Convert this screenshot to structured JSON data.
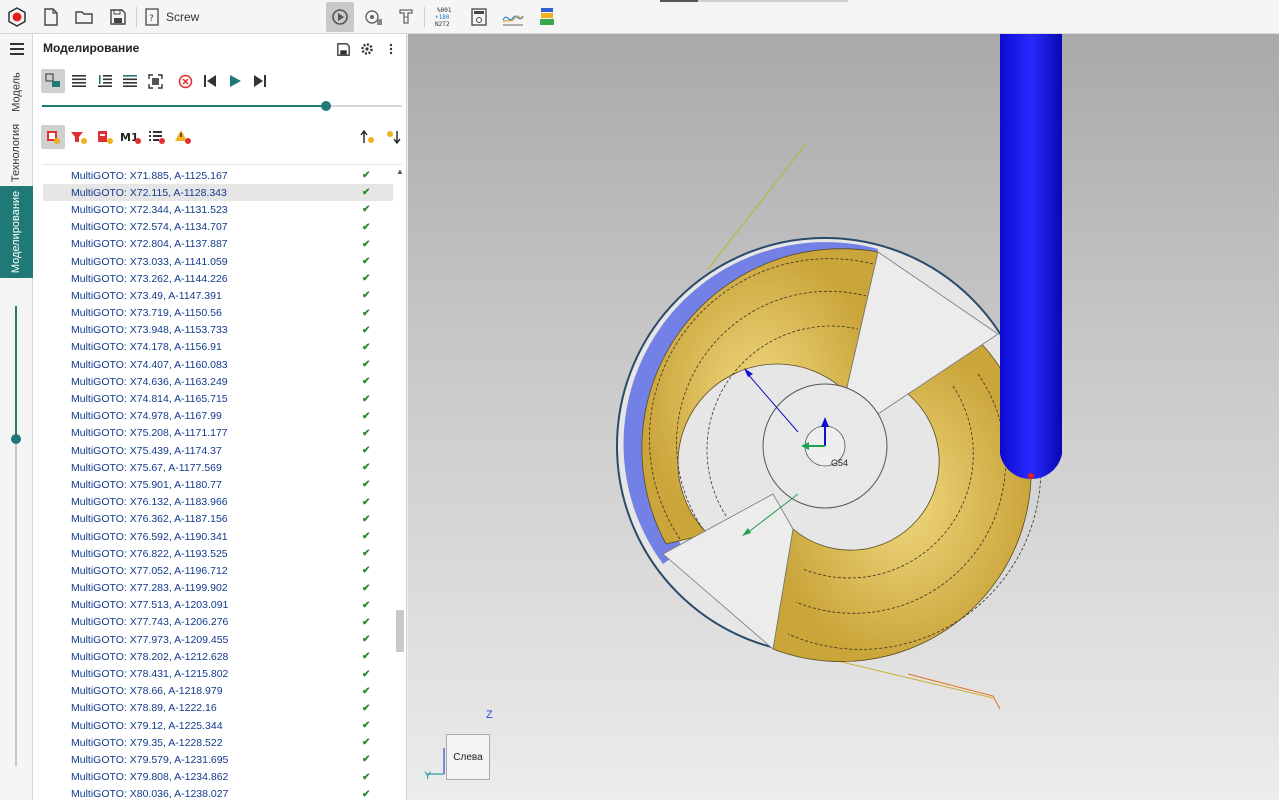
{
  "toolbar": {
    "project_name": "Screw",
    "icons": [
      "app-logo-icon",
      "new-file-icon",
      "open-folder-icon",
      "save-icon",
      "project-icon",
      "simulation-icon",
      "machine-icon",
      "tool-icon",
      "ncode-icon",
      "calculator-icon",
      "chart-icon",
      "postprocessor-icon"
    ],
    "ncode_label_top": "%001",
    "ncode_label_mid": "+180",
    "ncode_label_bot": "N2T2"
  },
  "rail": {
    "tabs": [
      {
        "label": "Модель"
      },
      {
        "label": "Технология"
      },
      {
        "label": "Моделирование"
      }
    ]
  },
  "panel": {
    "title": "Моделирование",
    "progress_fraction": 0.79,
    "metric_label": "M1",
    "operations": [
      {
        "text": "MultiGOTO: X71.885, A-1125.167",
        "status": "✔"
      },
      {
        "text": "MultiGOTO: X72.115, A-1128.343",
        "status": "✔"
      },
      {
        "text": "MultiGOTO: X72.344, A-1131.523",
        "status": "✔"
      },
      {
        "text": "MultiGOTO: X72.574, A-1134.707",
        "status": "✔"
      },
      {
        "text": "MultiGOTO: X72.804, A-1137.887",
        "status": "✔"
      },
      {
        "text": "MultiGOTO: X73.033, A-1141.059",
        "status": "✔"
      },
      {
        "text": "MultiGOTO: X73.262, A-1144.226",
        "status": "✔"
      },
      {
        "text": "MultiGOTO: X73.49, A-1147.391",
        "status": "✔"
      },
      {
        "text": "MultiGOTO: X73.719, A-1150.56",
        "status": "✔"
      },
      {
        "text": "MultiGOTO: X73.948, A-1153.733",
        "status": "✔"
      },
      {
        "text": "MultiGOTO: X74.178, A-1156.91",
        "status": "✔"
      },
      {
        "text": "MultiGOTO: X74.407, A-1160.083",
        "status": "✔"
      },
      {
        "text": "MultiGOTO: X74.636, A-1163.249",
        "status": "✔"
      },
      {
        "text": "MultiGOTO: X74.814, A-1165.715",
        "status": "✔"
      },
      {
        "text": "MultiGOTO: X74.978, A-1167.99",
        "status": "✔"
      },
      {
        "text": "MultiGOTO: X75.208, A-1171.177",
        "status": "✔"
      },
      {
        "text": "MultiGOTO: X75.439, A-1174.37",
        "status": "✔"
      },
      {
        "text": "MultiGOTO: X75.67, A-1177.569",
        "status": "✔"
      },
      {
        "text": "MultiGOTO: X75.901, A-1180.77",
        "status": "✔"
      },
      {
        "text": "MultiGOTO: X76.132, A-1183.966",
        "status": "✔"
      },
      {
        "text": "MultiGOTO: X76.362, A-1187.156",
        "status": "✔"
      },
      {
        "text": "MultiGOTO: X76.592, A-1190.341",
        "status": "✔"
      },
      {
        "text": "MultiGOTO: X76.822, A-1193.525",
        "status": "✔"
      },
      {
        "text": "MultiGOTO: X77.052, A-1196.712",
        "status": "✔"
      },
      {
        "text": "MultiGOTO: X77.283, A-1199.902",
        "status": "✔"
      },
      {
        "text": "MultiGOTO: X77.513, A-1203.091",
        "status": "✔"
      },
      {
        "text": "MultiGOTO: X77.743, A-1206.276",
        "status": "✔"
      },
      {
        "text": "MultiGOTO: X77.973, A-1209.455",
        "status": "✔"
      },
      {
        "text": "MultiGOTO: X78.202, A-1212.628",
        "status": "✔"
      },
      {
        "text": "MultiGOTO: X78.431, A-1215.802",
        "status": "✔"
      },
      {
        "text": "MultiGOTO: X78.66, A-1218.979",
        "status": "✔"
      },
      {
        "text": "MultiGOTO: X78.89, A-1222.16",
        "status": "✔"
      },
      {
        "text": "MultiGOTO: X79.12, A-1225.344",
        "status": "✔"
      },
      {
        "text": "MultiGOTO: X79.35, A-1228.522",
        "status": "✔"
      },
      {
        "text": "MultiGOTO: X79.579, A-1231.695",
        "status": "✔"
      },
      {
        "text": "MultiGOTO: X79.808, A-1234.862",
        "status": "✔"
      },
      {
        "text": "MultiGOTO: X80.036, A-1238.027",
        "status": "✔"
      }
    ],
    "selected_index": 1
  },
  "viewport": {
    "view_label": "Слева",
    "axis_z": "Z",
    "axis_y": "Y",
    "cs_label": "G54",
    "colors": {
      "tool": "#1010e8",
      "part": "#e2c25a",
      "stock": "#e6e6e6",
      "gouge": "#5e6fe6",
      "accent": "#1f7a77"
    }
  }
}
